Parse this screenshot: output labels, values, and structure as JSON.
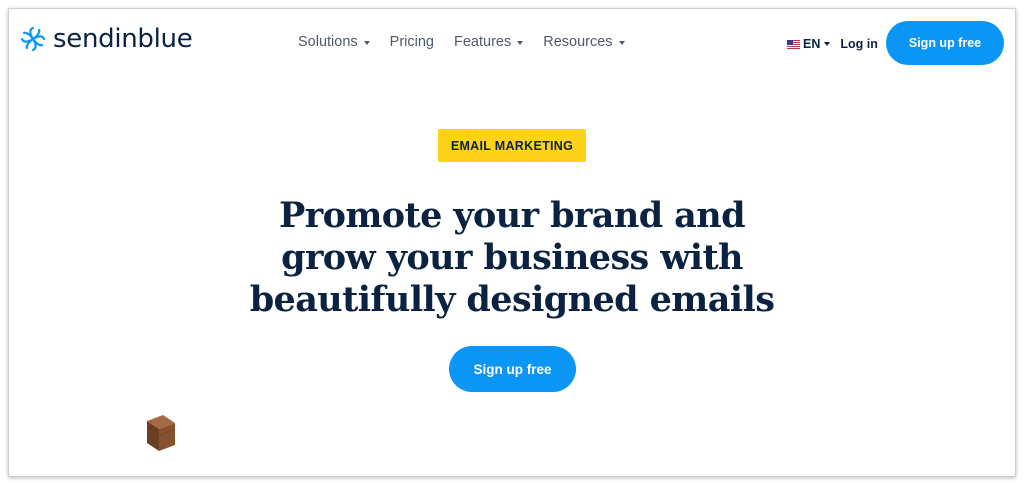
{
  "brand": {
    "name": "sendinblue",
    "color": "#0b96f5",
    "dark": "#0b2240"
  },
  "nav": {
    "items": [
      {
        "label": "Solutions",
        "has_caret": true
      },
      {
        "label": "Pricing",
        "has_caret": false
      },
      {
        "label": "Features",
        "has_caret": true
      },
      {
        "label": "Resources",
        "has_caret": true
      }
    ]
  },
  "header": {
    "language": "EN",
    "login": "Log in",
    "signup": "Sign up free"
  },
  "hero": {
    "badge": "EMAIL MARKETING",
    "badge_color": "#ffd119",
    "headline_line1": "Promote your brand and",
    "headline_line2": "grow your business with",
    "headline_line3": "beautifully designed emails",
    "cta": "Sign up free"
  }
}
